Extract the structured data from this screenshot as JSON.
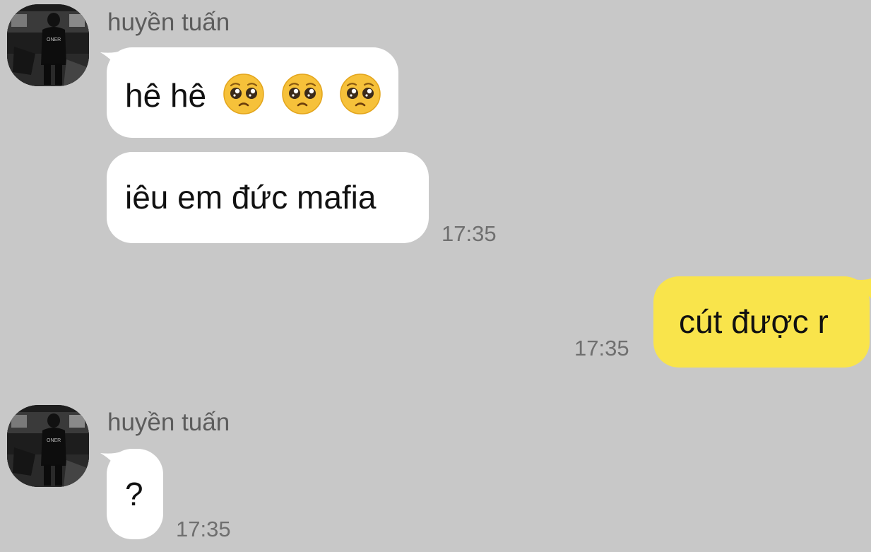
{
  "messages": [
    {
      "sender": "huyền tuấn",
      "bubbles": [
        {
          "text": "hê hê",
          "emojis": [
            "pleading-face",
            "pleading-face",
            "pleading-face"
          ]
        },
        {
          "text": "iêu em đức mafia",
          "time": "17:35"
        }
      ]
    },
    {
      "outgoing": true,
      "text": "cút được r",
      "time": "17:35"
    },
    {
      "sender": "huyền tuấn",
      "bubbles": [
        {
          "text": "?",
          "time": "17:35"
        }
      ]
    }
  ],
  "colors": {
    "background": "#c8c8c8",
    "incoming_bubble": "#ffffff",
    "outgoing_bubble": "#f9e44b",
    "timestamp": "#6f6f6f",
    "sender_name": "#5c5c5c"
  },
  "avatar_icon": "profile-photo-icon",
  "emoji_icon": "pleading-face-icon"
}
